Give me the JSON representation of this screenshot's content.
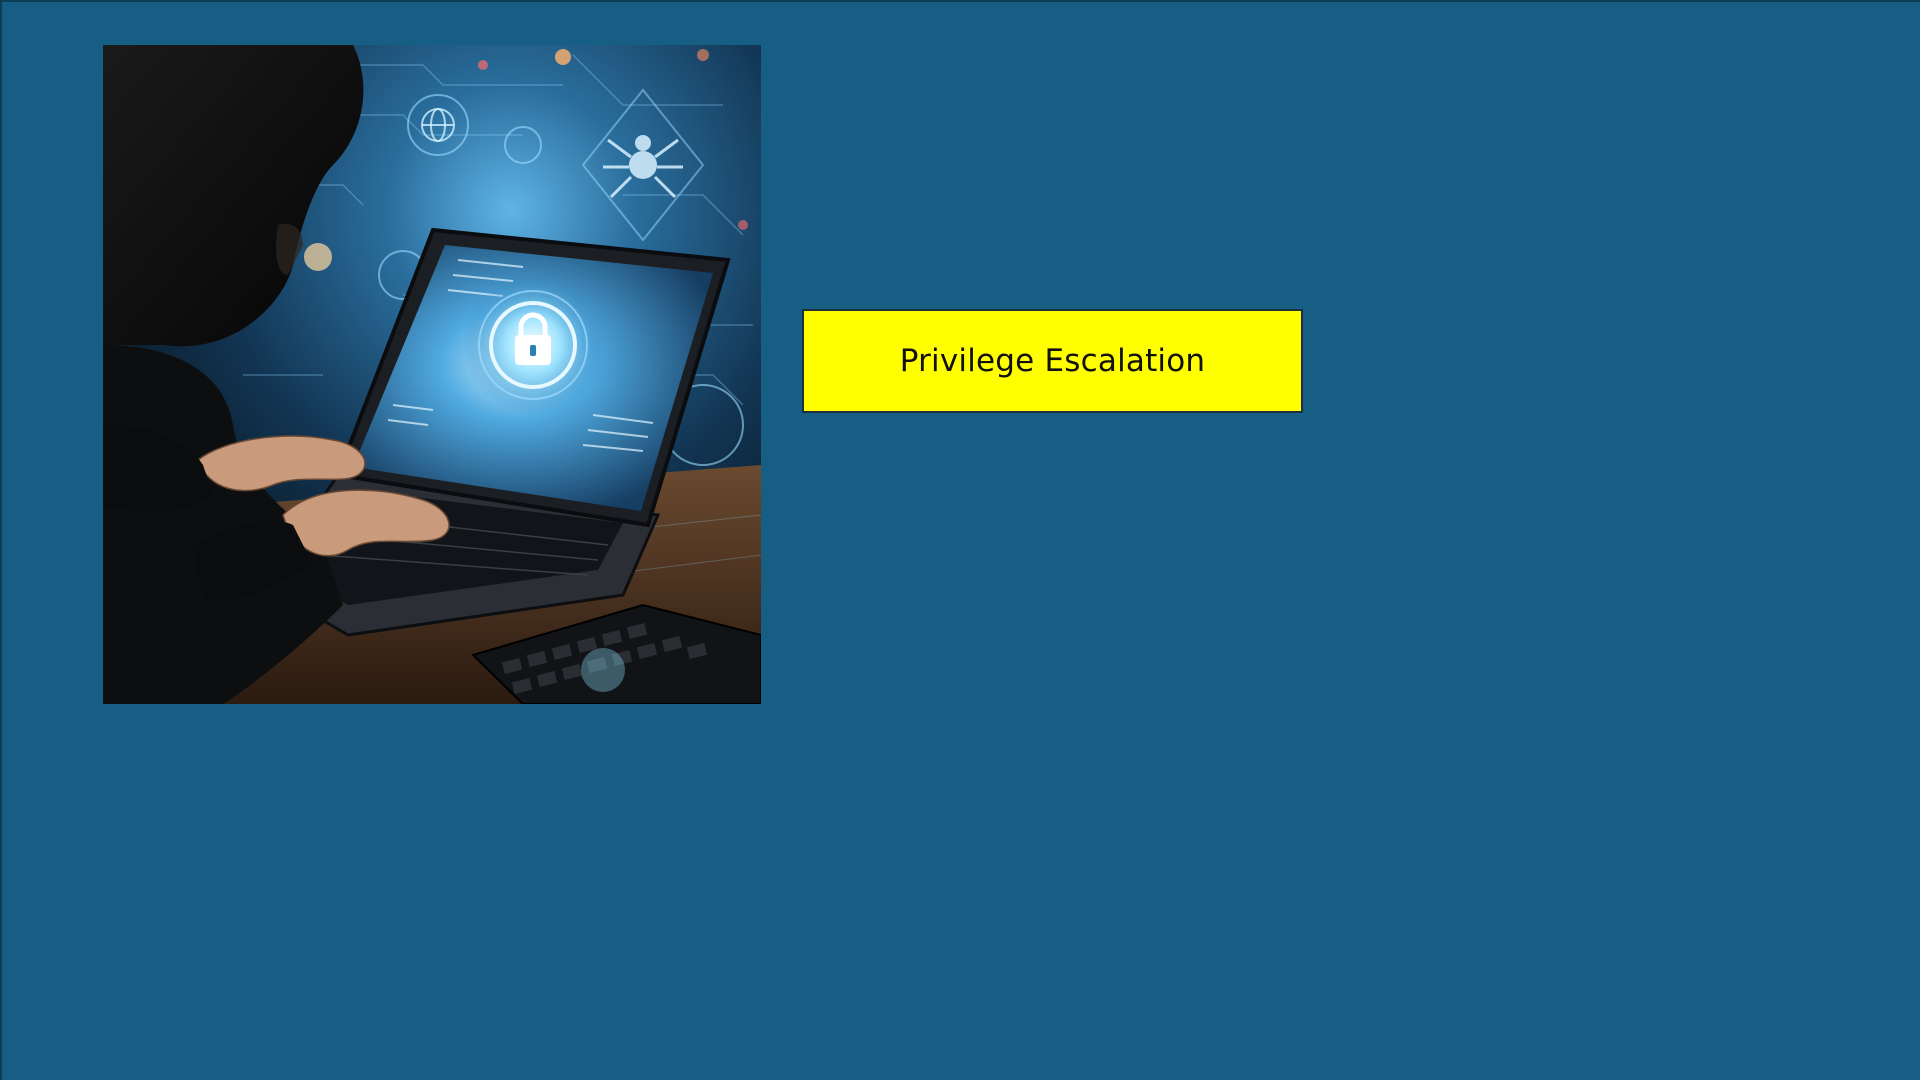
{
  "slide": {
    "background_color": "#165e84",
    "image": {
      "subject_icons": [
        "hooded-figure-icon",
        "laptop-icon",
        "padlock-icon",
        "keyboard-icon",
        "spider-icon",
        "globe-icon"
      ]
    },
    "label": {
      "text": "Privilege Escalation",
      "background_color": "#ffff00",
      "text_color": "#111111"
    }
  }
}
